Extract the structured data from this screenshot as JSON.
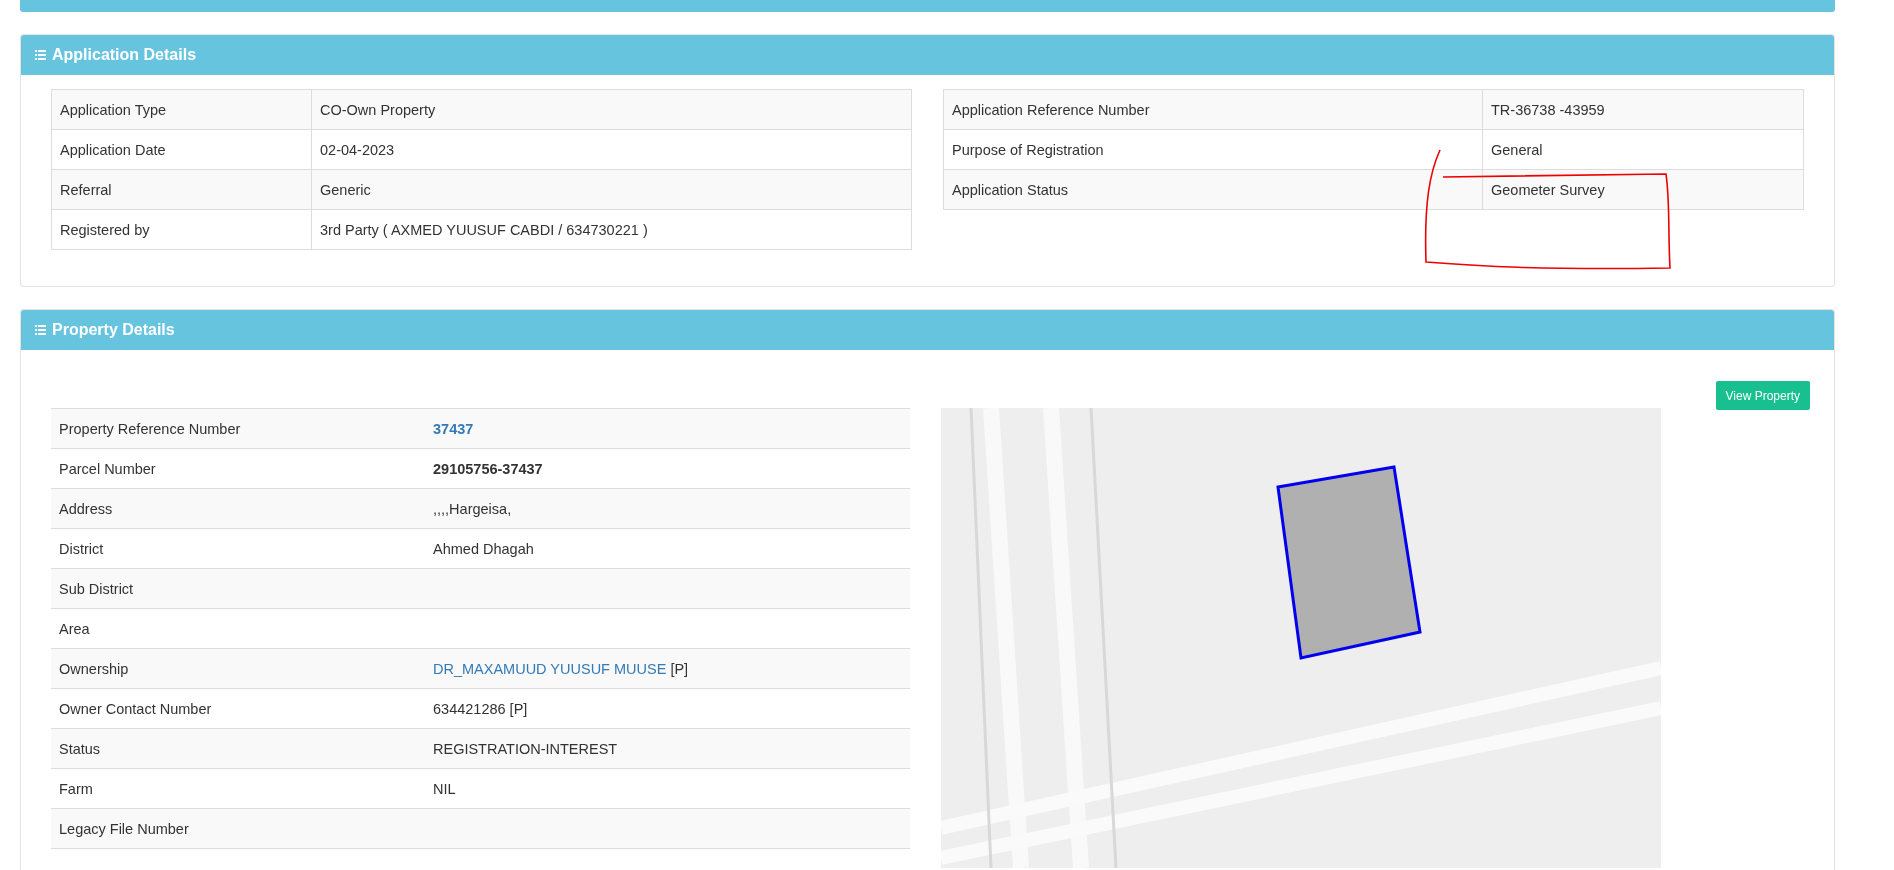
{
  "application_details": {
    "title": "Application Details",
    "left_table": [
      {
        "label": "Application Type",
        "value": "CO-Own Property"
      },
      {
        "label": "Application Date",
        "value": "02-04-2023"
      },
      {
        "label": "Referral",
        "value": "Generic"
      },
      {
        "label": "Registered by",
        "value": "3rd Party ( AXMED YUUSUF CABDI / 634730221 )"
      }
    ],
    "right_table": [
      {
        "label": "Application Reference Number",
        "value": "TR-36738 -43959"
      },
      {
        "label": "Purpose of Registration",
        "value": "General"
      },
      {
        "label": "Application Status",
        "value": "Geometer Survey"
      }
    ]
  },
  "property_details": {
    "title": "Property Details",
    "button": "View Property",
    "rows": [
      {
        "label": "Property Reference Number",
        "value": "37437",
        "kind": "bold-link"
      },
      {
        "label": "Parcel Number",
        "value": "29105756-37437",
        "kind": "bold"
      },
      {
        "label": "Address",
        "value": ",,,,Hargeisa,",
        "kind": "plain"
      },
      {
        "label": "District",
        "value": "Ahmed Dhagah",
        "kind": "plain"
      },
      {
        "label": "Sub District"
      },
      {
        "label": "Area"
      },
      {
        "label": "Ownership",
        "value": "DR_MAXAMUUD YUUSUF MUUSE",
        "suffix": "[P]",
        "kind": "link"
      },
      {
        "label": "Owner Contact Number",
        "value": "634421286 [P]",
        "kind": "plain"
      },
      {
        "label": "Status",
        "value": "REGISTRATION-INTEREST",
        "kind": "plain"
      },
      {
        "label": "Farm",
        "value": "NIL",
        "kind": "plain"
      },
      {
        "label": "Legacy File Number"
      },
      {}
    ]
  }
}
